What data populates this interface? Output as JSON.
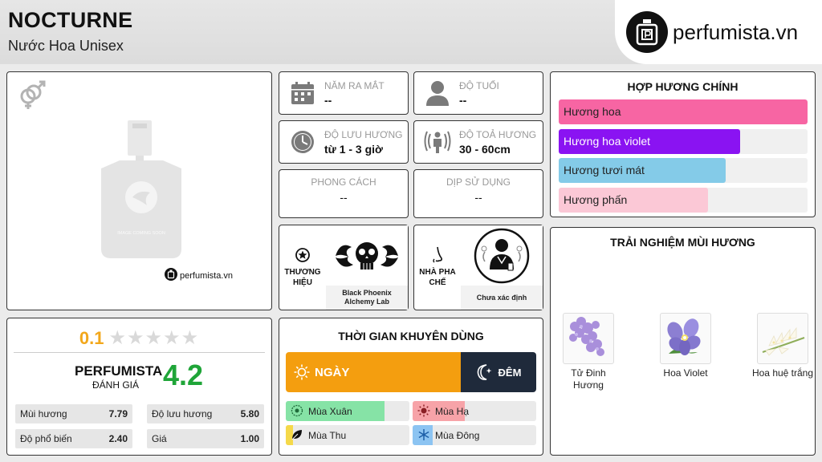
{
  "header": {
    "title": "NOCTURNE",
    "subtitle": "Nước Hoa Unisex",
    "logo_text": "perfumista.vn"
  },
  "image_card": {
    "image_placeholder_text": "IMAGE COMING SOON",
    "mini_logo_text": "perfumista.vn",
    "icon": "gender-unisex-icon"
  },
  "info": {
    "release_year": {
      "label": "NĂM RA MẮT",
      "value": "--",
      "icon": "calendar-icon"
    },
    "age": {
      "label": "ĐỘ TUỔI",
      "value": "--",
      "icon": "person-icon"
    },
    "longevity": {
      "label": "ĐỘ LƯU HƯƠNG",
      "value": "từ 1 - 3 giờ",
      "icon": "clock-icon"
    },
    "sillage": {
      "label": "ĐỘ TOẢ HƯƠNG",
      "value": "30 - 60cm",
      "icon": "radiate-icon"
    },
    "style": {
      "label": "PHONG CÁCH",
      "value": "--"
    },
    "occasion": {
      "label": "DỊP SỬ DỤNG",
      "value": "--"
    },
    "brand": {
      "label_line1": "THƯƠNG",
      "label_line2": "HIỆU",
      "name": "Black Phoenix Alchemy Lab",
      "icon": "star-badge-icon"
    },
    "perfumer": {
      "label_line1": "NHÀ PHA",
      "label_line2": "CHẾ",
      "name": "Chưa xác định",
      "icon": "nose-icon"
    }
  },
  "accords": {
    "title": "HỢP HƯƠNG CHÍNH",
    "items": [
      {
        "label": "Hương hoa",
        "value": 100,
        "color": "#f765a3",
        "text_color": "#222222"
      },
      {
        "label": "Hương hoa violet",
        "value": 73,
        "color": "#8a13f2",
        "text_color": "#ffffff"
      },
      {
        "label": "Hương tươi mát",
        "value": 67,
        "color": "#84cbe8",
        "text_color": "#222222"
      },
      {
        "label": "Hương phấn",
        "value": 60,
        "color": "#fbc8d6",
        "text_color": "#222222"
      }
    ]
  },
  "experience": {
    "title": "TRẢI NGHIỆM MÙI HƯƠNG",
    "notes": [
      {
        "name": "Tử Đinh Hương",
        "icon": "lilac-icon"
      },
      {
        "name": "Hoa Violet",
        "icon": "violet-icon"
      },
      {
        "name": "Hoa huệ trắng",
        "icon": "tuberose-icon"
      }
    ]
  },
  "rating": {
    "user_score": "0.1",
    "stars_total": 5,
    "stars_filled": 0,
    "perfumista_label": "PERFUMISTA",
    "perfumista_sub": "ĐÁNH GIÁ",
    "perfumista_score": "4.2",
    "stats": [
      {
        "label": "Mùi hương",
        "value": "7.79"
      },
      {
        "label": "Độ lưu hương",
        "value": "5.80"
      },
      {
        "label": "Độ phổ biến",
        "value": "2.40"
      },
      {
        "label": "Giá",
        "value": "1.00"
      }
    ]
  },
  "time": {
    "title": "THỜI GIAN KHUYÊN DÙNG",
    "day_label": "NGÀY",
    "night_label": "ĐÊM",
    "day_share": 0.7,
    "seasons": [
      {
        "label": "Mùa Xuân",
        "value": 80,
        "color": "#86e3a6",
        "icon": "spring-icon"
      },
      {
        "label": "Mùa Hạ",
        "value": 42,
        "color": "#f7a3a8",
        "icon": "sun-icon"
      },
      {
        "label": "Mùa Thu",
        "value": 6,
        "color": "#f5d94a",
        "icon": "leaf-icon"
      },
      {
        "label": "Mùa Đông",
        "value": 16,
        "color": "#8cc4f2",
        "icon": "snowflake-icon"
      }
    ]
  }
}
